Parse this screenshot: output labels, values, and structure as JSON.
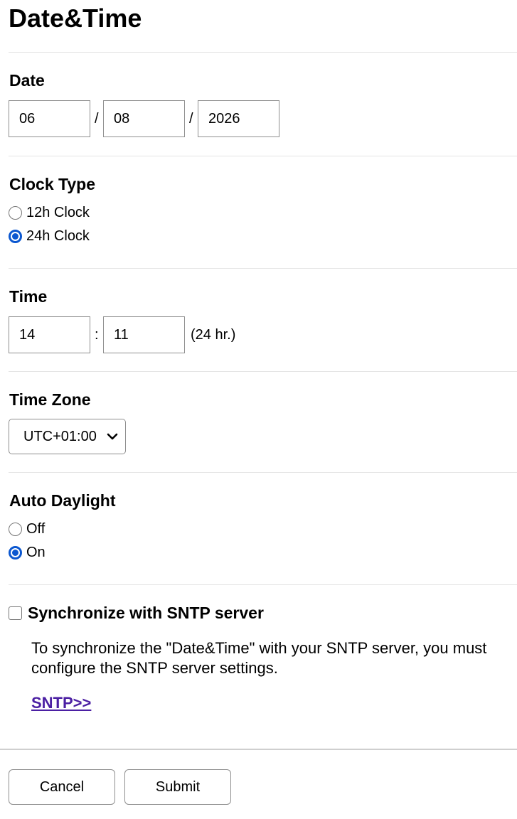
{
  "page_title": "Date&Time",
  "date": {
    "label": "Date",
    "month": "06",
    "day": "08",
    "year": "2026",
    "separator": "/"
  },
  "clock_type": {
    "label": "Clock Type",
    "options": [
      "12h Clock",
      "24h Clock"
    ],
    "selected": "24h Clock"
  },
  "time": {
    "label": "Time",
    "hour": "14",
    "minute": "11",
    "separator": ":",
    "suffix": "(24 hr.)"
  },
  "time_zone": {
    "label": "Time Zone",
    "selected": "UTC+01:00"
  },
  "auto_daylight": {
    "label": "Auto Daylight",
    "options": [
      "Off",
      "On"
    ],
    "selected": "On"
  },
  "sntp": {
    "checkbox_label": "Synchronize with SNTP server",
    "checked": false,
    "info": "To synchronize the \"Date&Time\" with your SNTP server, you must configure the SNTP server settings.",
    "link": "SNTP>>"
  },
  "buttons": {
    "cancel": "Cancel",
    "submit": "Submit"
  },
  "colors": {
    "accent": "#0b57d0",
    "link": "#4b1fa3"
  }
}
